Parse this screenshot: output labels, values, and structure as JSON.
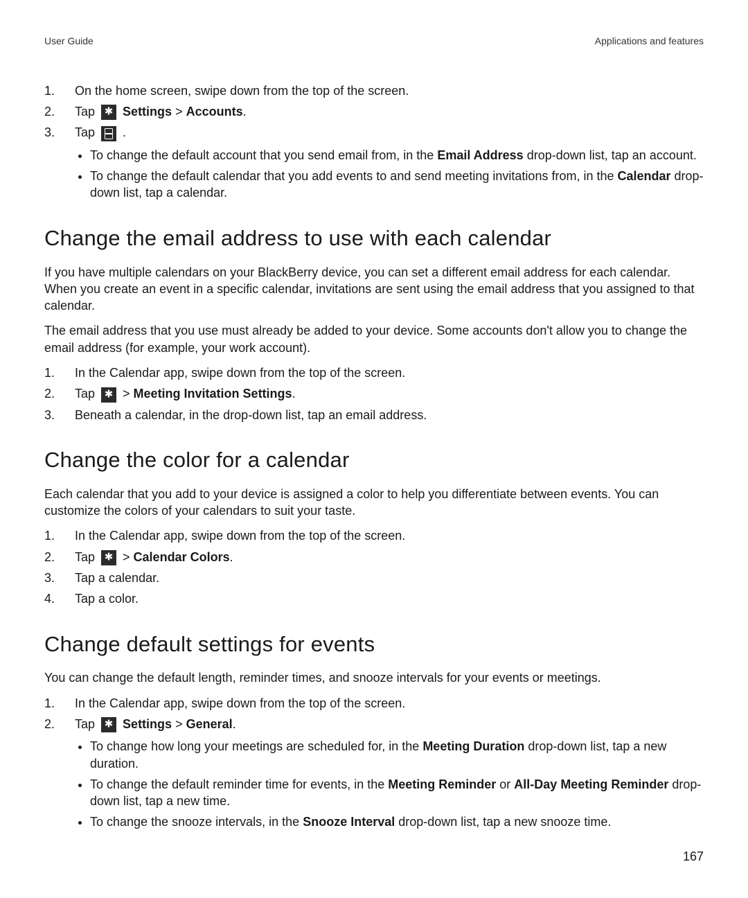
{
  "header": {
    "left": "User Guide",
    "right": "Applications and features"
  },
  "pageNum": "167",
  "introSteps": {
    "s1": "On the home screen, swipe down from the top of the screen.",
    "s2a": "Tap ",
    "s2b": "Settings",
    "s2c": " > ",
    "s2d": "Accounts",
    "s2e": ".",
    "s3a": "Tap ",
    "s3b": " .",
    "b1a": "To change the default account that you send email from, in the ",
    "b1b": "Email Address",
    "b1c": " drop-down list, tap an account.",
    "b2a": "To change the default calendar that you add events to and send meeting invitations from, in the ",
    "b2b": "Calendar",
    "b2c": " drop-down list, tap a calendar."
  },
  "sec1": {
    "heading": "Change the email address to use with each calendar",
    "p1": "If you have multiple calendars on your BlackBerry device, you can set a different email address for each calendar. When you create an event in a specific calendar, invitations are sent using the email address that you assigned to that calendar.",
    "p2": "The email address that you use must already be added to your device. Some accounts don't allow you to change the email address (for example, your work account).",
    "s1": "In the Calendar app, swipe down from the top of the screen.",
    "s2a": "Tap ",
    "s2b": " > ",
    "s2c": "Meeting Invitation Settings",
    "s2d": ".",
    "s3": "Beneath a calendar, in the drop-down list, tap an email address."
  },
  "sec2": {
    "heading": "Change the color for a calendar",
    "p1": "Each calendar that you add to your device is assigned a color to help you differentiate between events. You can customize the colors of your calendars to suit your taste.",
    "s1": "In the Calendar app, swipe down from the top of the screen.",
    "s2a": "Tap ",
    "s2b": " > ",
    "s2c": "Calendar Colors",
    "s2d": ".",
    "s3": "Tap a calendar.",
    "s4": "Tap a color."
  },
  "sec3": {
    "heading": "Change default settings for events",
    "p1": "You can change the default length, reminder times, and snooze intervals for your events or meetings.",
    "s1": "In the Calendar app, swipe down from the top of the screen.",
    "s2a": "Tap ",
    "s2b": "Settings",
    "s2c": " > ",
    "s2d": "General",
    "s2e": ".",
    "b1a": "To change how long your meetings are scheduled for, in the ",
    "b1b": "Meeting Duration",
    "b1c": " drop-down list, tap a new duration.",
    "b2a": "To change the default reminder time for events, in the ",
    "b2b": "Meeting Reminder",
    "b2c": " or ",
    "b2d": "All-Day Meeting Reminder",
    "b2e": " drop-down list, tap a new time.",
    "b3a": "To change the snooze intervals, in the ",
    "b3b": "Snooze Interval",
    "b3c": " drop-down list, tap a new snooze time."
  }
}
